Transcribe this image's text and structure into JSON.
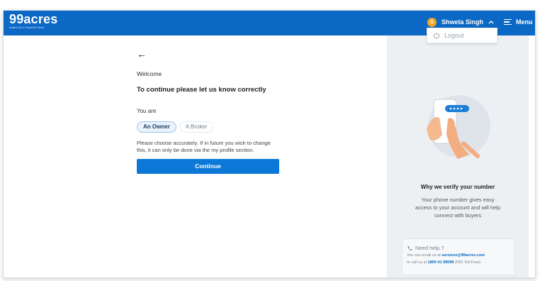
{
  "header": {
    "logo": "99acres",
    "tagline": "India's No.1 Property Portal",
    "user_initial": "S",
    "user_name": "Shweta Singh",
    "menu_label": "Menu",
    "logout_label": "Logout"
  },
  "main": {
    "back_arrow": "←",
    "welcome": "Welcome",
    "subtitle": "To continue please let us know correctly",
    "you_are": "You are",
    "options": [
      {
        "label": "An Owner",
        "selected": true
      },
      {
        "label": "A Broker",
        "selected": false
      }
    ],
    "note": "Please choose accurately. If in future you wish to change this, it can only be done via the my profile section.",
    "continue_label": "Continue"
  },
  "side": {
    "title": "Why we verify your number",
    "description": "Your phone number gives easy access to your account and will help connect with buyers",
    "help_title": "Need help ?",
    "help_email_prefix": "You can email us at",
    "help_email": "services@99acres.com",
    "help_call_prefix": "or call us at",
    "help_phone": "1800 41 99099",
    "help_phone_suffix": "(IND Toll-Free)."
  },
  "colors": {
    "header_bg": "#0b68c4",
    "button_bg": "#0b78d8",
    "avatar_bg": "#f5a623",
    "sidebar_bg": "#edf0f3"
  },
  "icons": [
    "chevron-up-icon",
    "hamburger-menu-icon",
    "power-icon",
    "back-arrow-icon",
    "phone-icon"
  ]
}
